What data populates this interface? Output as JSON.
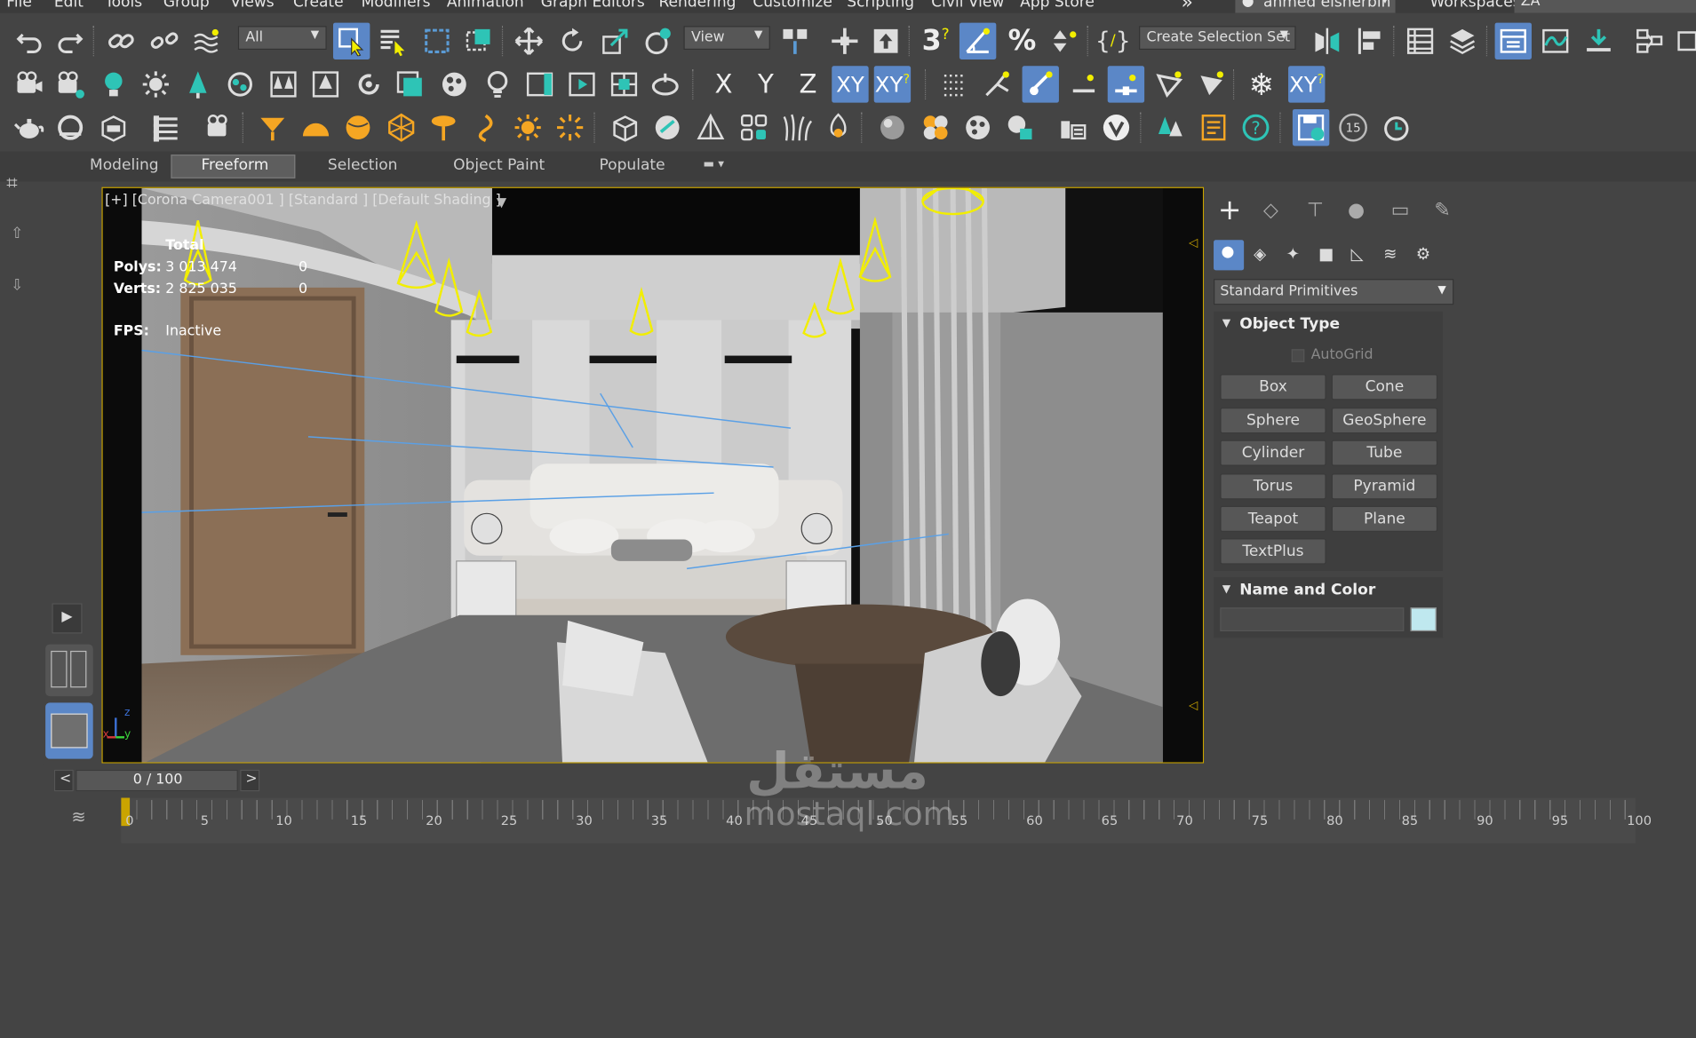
{
  "menu": [
    "File",
    "Edit",
    "Tools",
    "Group",
    "Views",
    "Create",
    "Modifiers",
    "Animation",
    "Graph Editors",
    "Rendering",
    "Customize",
    "Scripting",
    "Civil View",
    "App Store"
  ],
  "user": {
    "name": "ahmed elsherbin"
  },
  "workspaces": {
    "label": "Workspaces:",
    "value": "ZA"
  },
  "toolbar": {
    "filter": "All",
    "ref_coord": "View",
    "selection_set": "Create Selection Set"
  },
  "axis_buttons": [
    "X",
    "Y",
    "Z",
    "XY",
    "XY"
  ],
  "badge_15": "15",
  "snap_label": "3",
  "ribbon_tabs": [
    "Modeling",
    "Freeform",
    "Selection",
    "Object Paint",
    "Populate"
  ],
  "viewport": {
    "label": "[+] [Corona Camera001 ] [Standard ] [Default Shading ]",
    "stats_header": "Total",
    "polys_label": "Polys:",
    "polys_value": "3 013 474",
    "polys_sel": "0",
    "verts_label": "Verts:",
    "verts_value": "2 825 035",
    "verts_sel": "0",
    "fps_label": "FPS:",
    "fps_value": "Inactive",
    "axis_z": "z",
    "axis_x": "x",
    "axis_y": "y"
  },
  "panel": {
    "category": "Standard Primitives",
    "object_type": "Object Type",
    "autogrid": "AutoGrid",
    "buttons": [
      "Box",
      "Cone",
      "Sphere",
      "GeoSphere",
      "Cylinder",
      "Tube",
      "Torus",
      "Pyramid",
      "Teapot",
      "Plane",
      "TextPlus"
    ],
    "name_color": "Name and Color",
    "swatch": "#bfe8ef"
  },
  "timeline": {
    "frame": "0 / 100",
    "ticks": [
      "0",
      "5",
      "10",
      "15",
      "20",
      "25",
      "30",
      "35",
      "40",
      "45",
      "50",
      "55",
      "60",
      "65",
      "70",
      "75",
      "80",
      "85",
      "90",
      "95",
      "100"
    ]
  },
  "watermark": {
    "arabic": "مستقل",
    "latin": "mostaql.com"
  },
  "colors": {
    "accent": "#5b87c7",
    "viewport_border": "#caa400",
    "light": "#f2ee00"
  }
}
